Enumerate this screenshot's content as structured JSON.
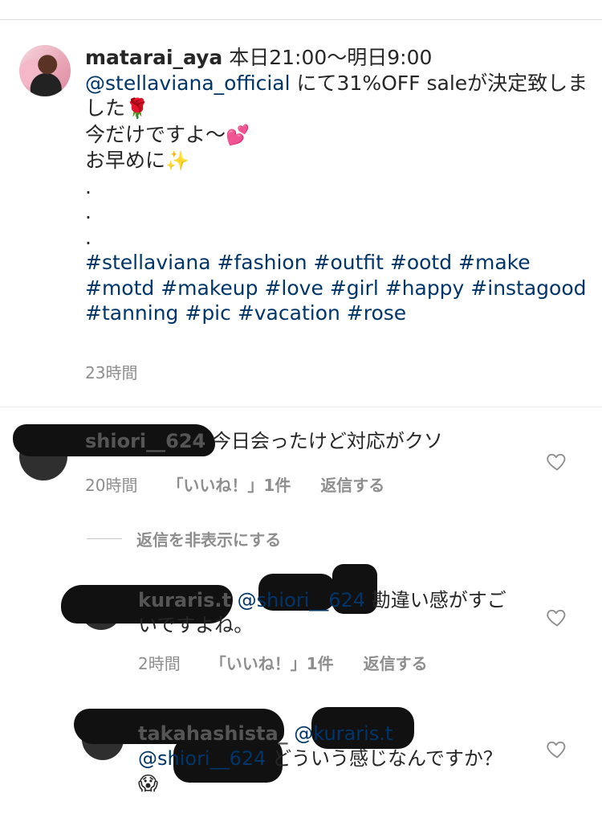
{
  "post": {
    "username": "matarai_aya",
    "line1_rest": "本日21:00〜明日9:00",
    "mention": "@stellaviana_official",
    "line2_rest": "にて31%OFF saleが決定致しました",
    "line3": "今だけですよ〜",
    "line4": "お早めに",
    "dot": ".",
    "hashtags": "#stellaviana #fashion #outfit #ootd #make #motd #makeup #love #girl #happy #instagood #tanning #pic #vacation #rose",
    "time": "23時間"
  },
  "comments": [
    {
      "username": "shiori__624",
      "text": "今日会ったけど対応がクソ",
      "time": "20時間",
      "likes": "「いいね！」1件",
      "reply": "返信する"
    }
  ],
  "hide_replies": "返信を非表示にする",
  "replies": [
    {
      "username": "kuraris.t",
      "mention": "@shiori__624",
      "text": "勘違い感がすごいですよね。",
      "time": "2時間",
      "likes": "「いいね！」1件",
      "reply": "返信する"
    },
    {
      "username": "takahashista_",
      "mention": "@kuraris.t @shiori__624",
      "text": "どういう感じなんですか？"
    }
  ],
  "icons": {
    "rose": "🌹",
    "hearts": "💕",
    "sparkles": "✨",
    "scream": "😱",
    "like": "heart-outline-icon"
  }
}
